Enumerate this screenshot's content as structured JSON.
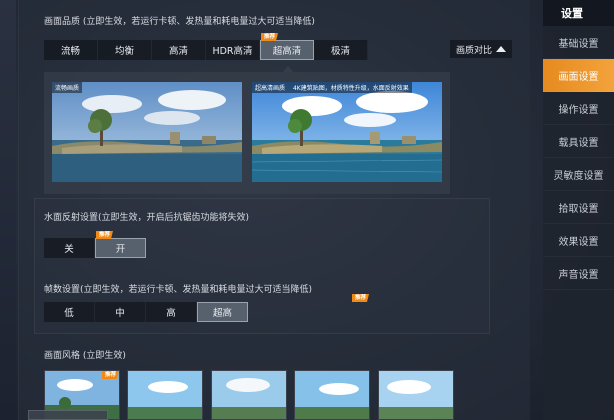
{
  "graphics_quality": {
    "title": "画面品质 (立即生效，若运行卡顿、发热量和耗电量过大可适当降低)",
    "options": [
      "流畅",
      "均衡",
      "高清",
      "HDR高清",
      "超高清",
      "极清"
    ],
    "selected": "超高清",
    "badge": "推荐",
    "compare_label": "画质对比"
  },
  "preview": {
    "left_caption": "流畅画质",
    "right_caption": "超高清画质",
    "right_tag": "4K建筑贴图，材质特性升级，水面反射效果"
  },
  "water_reflection": {
    "title": "水面反射设置(立即生效，开启后抗锯齿功能将失效)",
    "options": [
      "关",
      "开"
    ],
    "selected": "开",
    "badge": "推荐"
  },
  "frame_rate": {
    "title": "帧数设置(立即生效，若运行卡顿、发热量和耗电量过大可适当降低)",
    "options": [
      "低",
      "中",
      "高",
      "超高"
    ],
    "selected": "超高",
    "badge": "推荐"
  },
  "style": {
    "title": "画面风格 (立即生效)",
    "badge": "推荐"
  },
  "sidebar": {
    "header": "设置",
    "items": [
      "基础设置",
      "画面设置",
      "操作设置",
      "载具设置",
      "灵敏度设置",
      "拾取设置",
      "效果设置",
      "声音设置"
    ],
    "active": "画面设置"
  },
  "colors": {
    "accent": "#f08a16",
    "sidebar_active": "#e58a1f"
  }
}
